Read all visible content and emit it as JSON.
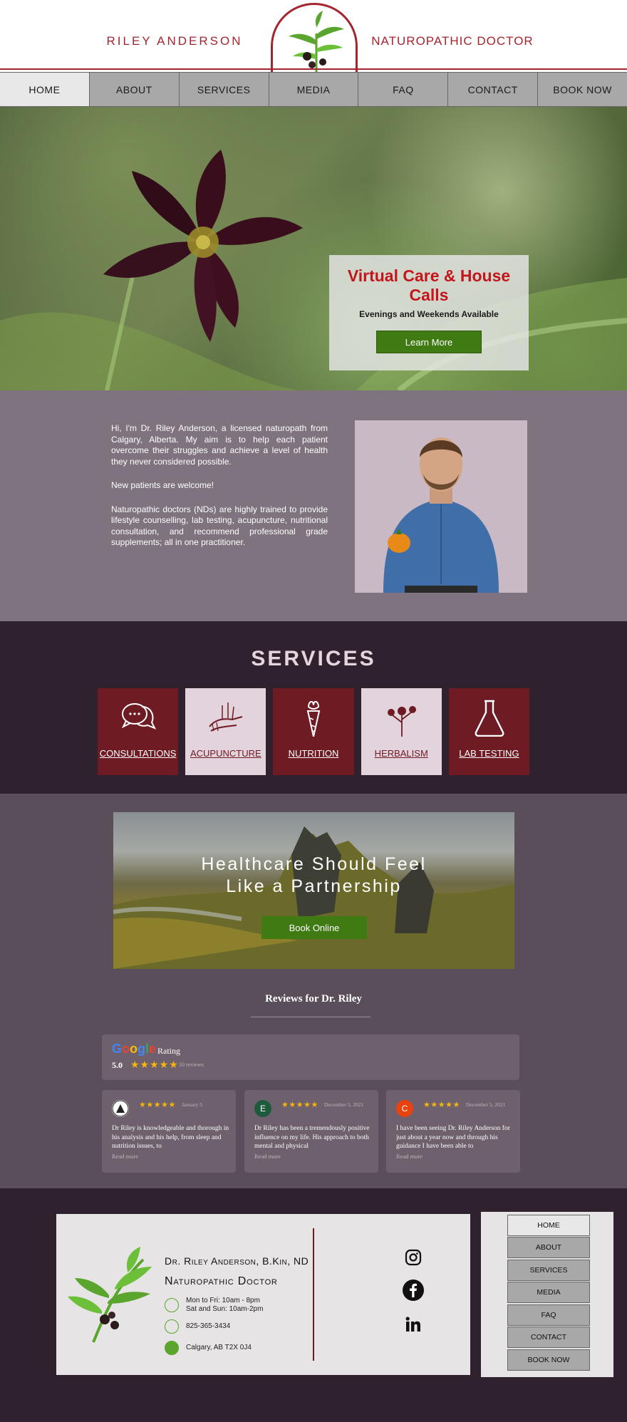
{
  "header": {
    "name": "RILEY ANDERSON",
    "title": "NATUROPATHIC DOCTOR"
  },
  "nav": {
    "items": [
      "HOME",
      "ABOUT",
      "SERVICES",
      "MEDIA",
      "FAQ",
      "CONTACT",
      "BOOK NOW"
    ],
    "active": "HOME"
  },
  "hero": {
    "heading": "Virtual Care & House Calls",
    "subheading": "Evenings and Weekends Available",
    "button": "Learn More"
  },
  "about": {
    "paragraphs": [
      "Hi, I'm Dr. Riley Anderson, a licensed naturopath from Calgary, Alberta. My aim is to help each patient overcome their struggles and achieve a level of health they never considered possible.",
      "New patients are welcome!",
      "Naturopathic doctors (NDs) are highly trained to provide lifestyle counselling, lab testing, acupuncture, nutritional consultation, and recommend professional grade supplements; all in one practitioner."
    ]
  },
  "services": {
    "heading": "SERVICES",
    "tiles": [
      {
        "label": "CONSULTATIONS",
        "icon": "chat-bubbles-icon"
      },
      {
        "label": "ACUPUNCTURE",
        "icon": "acupuncture-hand-icon"
      },
      {
        "label": "NUTRITION",
        "icon": "carrot-icon"
      },
      {
        "label": "HERBALISM",
        "icon": "herb-flower-icon"
      },
      {
        "label": "LAB TESTING",
        "icon": "flask-icon"
      }
    ]
  },
  "partnership": {
    "headline_line1": "Healthcare Should Feel",
    "headline_line2": "Like a Partnership",
    "button": "Book Online"
  },
  "reviews": {
    "title": "Reviews for Dr. Riley",
    "summary": {
      "brand": "Google",
      "label": "Rating",
      "score": "5.0",
      "stars": "★★★★★",
      "count": "10 reviews"
    },
    "cards": [
      {
        "avatar": "",
        "avatar_color": "#ffffff",
        "stars": "★★★★★",
        "date": "January 5",
        "text": "Dr Riley is knowledgeable and thorough in his analysis and his help, from sleep and nutrition issues, to",
        "more": "Read more"
      },
      {
        "avatar": "E",
        "avatar_color": "#1e5a3c",
        "stars": "★★★★★",
        "date": "December 5, 2021",
        "text": "Dr Riley has been a tremendously positive influence on my life. His approach to both mental and physical",
        "more": "Read more"
      },
      {
        "avatar": "C",
        "avatar_color": "#e8420f",
        "stars": "★★★★★",
        "date": "December 5, 2021",
        "text": "I have been seeing Dr. Riley Anderson for just about a year now and through his guidance I have been able to",
        "more": "Read more"
      }
    ]
  },
  "footer": {
    "name": "Dr. Riley Anderson, B.Kin, ND",
    "title": "Naturopathic Doctor",
    "hours": "Mon to Fri: 10am - 8pm\nSat and Sun: 10am-2pm",
    "phone": "825-365-3434",
    "address": "Calgary, AB T2X 0J4",
    "social": [
      "instagram-icon",
      "facebook-icon",
      "linkedin-icon"
    ],
    "menu": [
      "HOME",
      "ABOUT",
      "SERVICES",
      "MEDIA",
      "FAQ",
      "CONTACT",
      "BOOK NOW"
    ]
  },
  "colors": {
    "brand_red": "#a3262f",
    "wine": "#6e1b24",
    "aubergine": "#2f222e",
    "cta_green": "#3f7a12",
    "star": "#f6b40d"
  }
}
